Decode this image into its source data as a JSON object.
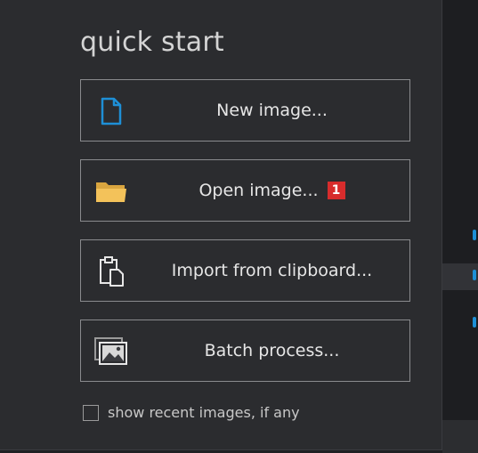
{
  "quick_start": {
    "title": "quick start",
    "buttons": [
      {
        "label": "New image...",
        "icon": "new-file-icon"
      },
      {
        "label": "Open image...",
        "icon": "folder-icon",
        "badge": "1"
      },
      {
        "label": "Import from clipboard...",
        "icon": "clipboard-icon"
      },
      {
        "label": "Batch process...",
        "icon": "batch-images-icon"
      }
    ],
    "show_recent_label": "show recent images, if any",
    "show_recent_checked": false
  },
  "colors": {
    "panel_bg": "#2b2c2f",
    "text": "#e6e6e6",
    "accent_blue": "#1e8fd6",
    "folder_yellow": "#f3c25a",
    "badge_red": "#d72c2c"
  }
}
